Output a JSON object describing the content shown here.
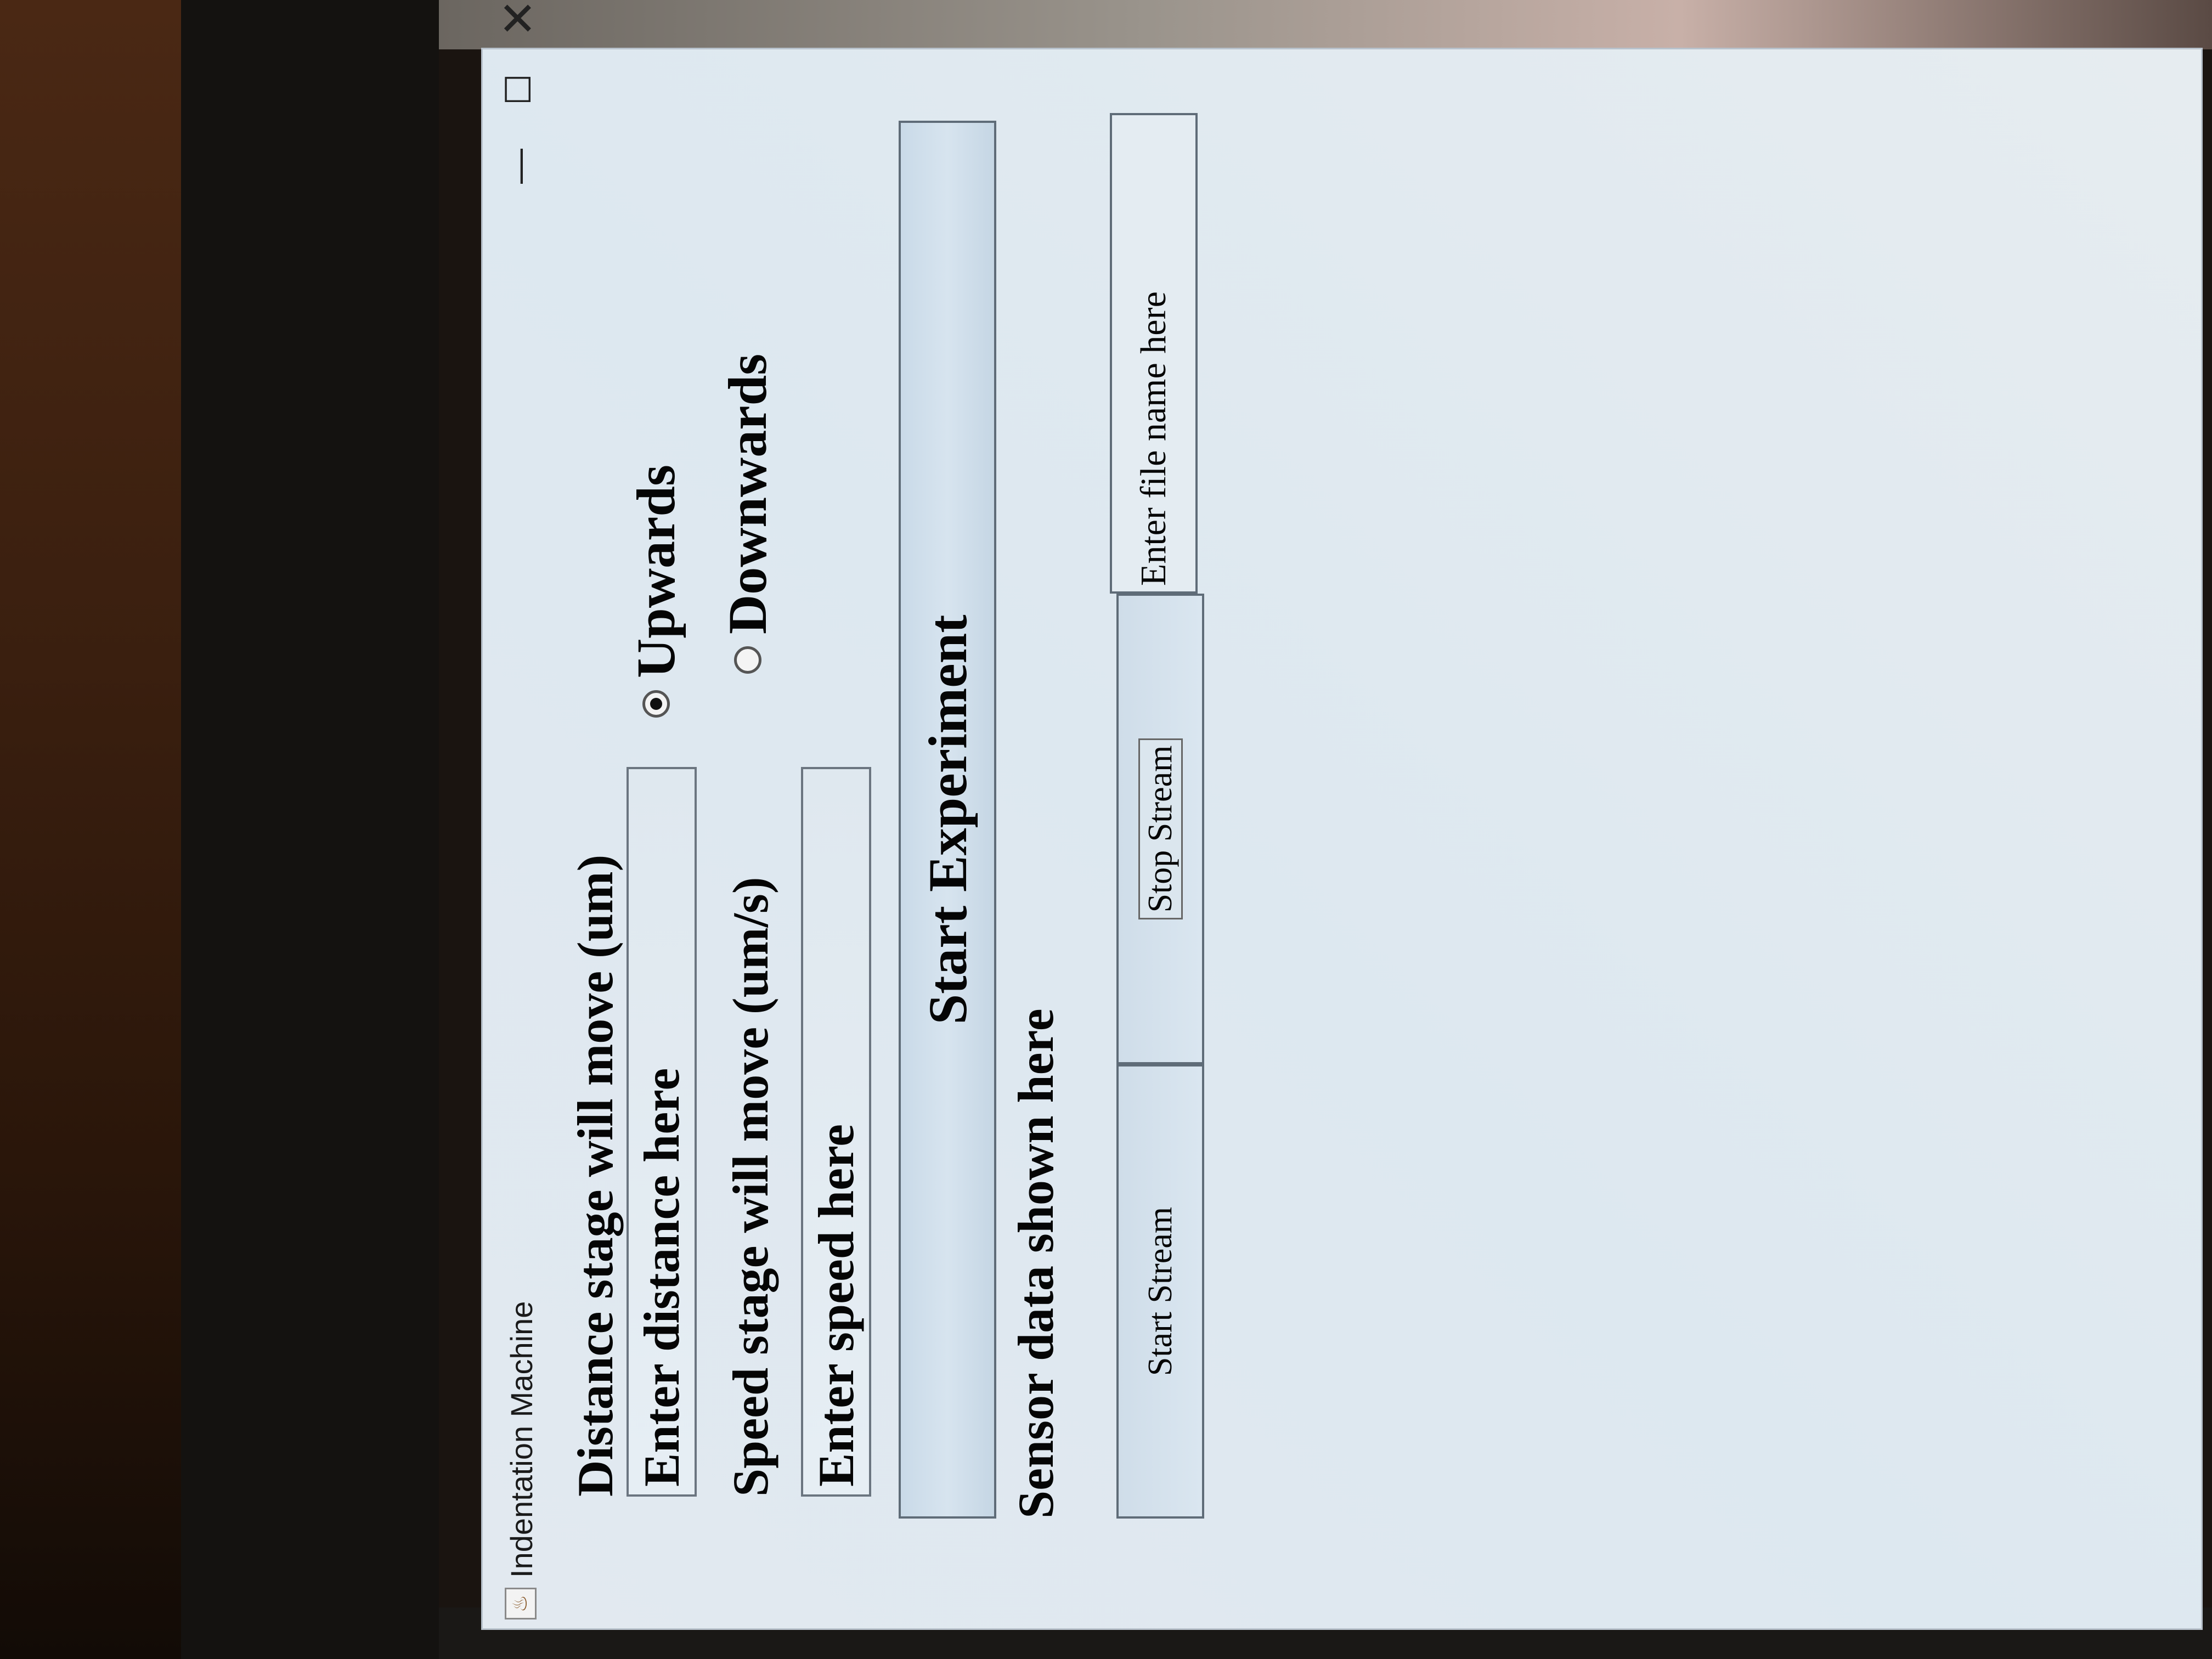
{
  "window": {
    "title": "Indentation Machine",
    "controls": {
      "minimize": "—",
      "maximize": "☐",
      "close": "✕"
    }
  },
  "distance": {
    "label": "Distance stage will move (um)",
    "placeholder": "Enter distance here"
  },
  "direction": {
    "options": [
      {
        "label": "Upwards",
        "selected": true
      },
      {
        "label": "Downwards",
        "selected": false
      }
    ]
  },
  "speed": {
    "label": "Speed stage will move (um/s)",
    "placeholder": "Enter speed here"
  },
  "start_experiment_label": "Start Experiment",
  "sensor": {
    "label": "Sensor data shown here"
  },
  "stream": {
    "start_label": "Start Stream",
    "stop_label": "Stop Stream",
    "file_placeholder": "Enter file name here"
  }
}
